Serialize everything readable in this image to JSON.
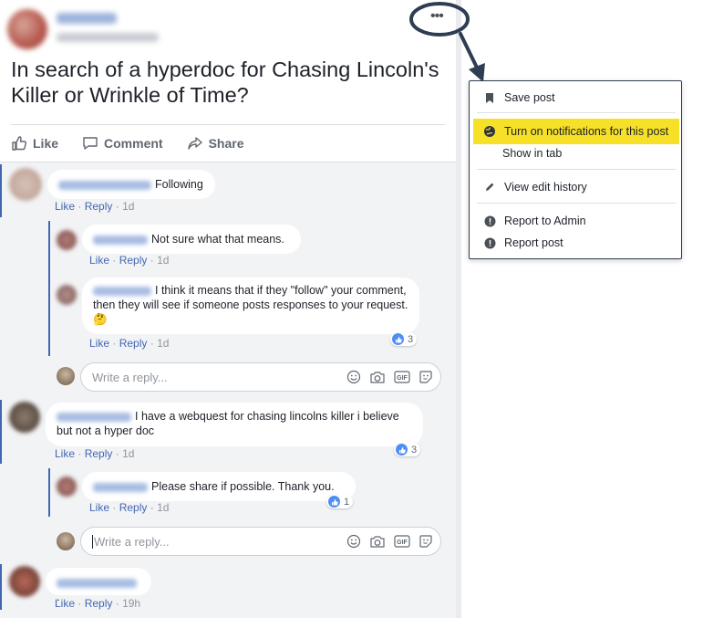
{
  "post": {
    "title": "In search of a hyperdoc for Chasing Lincoln's Killer or Wrinkle of Time?",
    "more_label": "•••",
    "actions": {
      "like": "Like",
      "comment": "Comment",
      "share": "Share"
    }
  },
  "comments": [
    {
      "text": "Following",
      "meta_like": "Like",
      "meta_reply": "Reply",
      "meta_time": "1d"
    },
    {
      "text": "Not sure what that means.",
      "meta_like": "Like",
      "meta_reply": "Reply",
      "meta_time": "1d"
    },
    {
      "text": "I think it means that if they \"follow\" your comment, then they will see if someone posts responses to your request.🤔",
      "meta_like": "Like",
      "meta_reply": "Reply",
      "meta_time": "1d",
      "reactions": "3"
    },
    {
      "text": "I have a webquest for chasing lincolns killer i believe but not a hyper doc",
      "meta_like": "Like",
      "meta_reply": "Reply",
      "meta_time": "1d",
      "reactions": "3"
    },
    {
      "text": "Please share if possible. Thank you.",
      "meta_like": "Like",
      "meta_reply": "Reply",
      "meta_time": "1d",
      "reactions": "1"
    },
    {
      "text": ".",
      "meta_like": "Like",
      "meta_reply": "Reply",
      "meta_time": "19h"
    }
  ],
  "reply_box": {
    "placeholder": "Write a reply...",
    "gif_label": "GIF"
  },
  "meta_separator": "·",
  "menu": {
    "save_post": "Save post",
    "notifications": "Turn on notifications for this post",
    "show_in_tab": "Show in tab",
    "view_edit_history": "View edit history",
    "report_admin": "Report to Admin",
    "report_post": "Report post"
  },
  "colors": {
    "link": "#4267b2",
    "highlight": "#f6e028",
    "annotation": "#2f3d52"
  }
}
